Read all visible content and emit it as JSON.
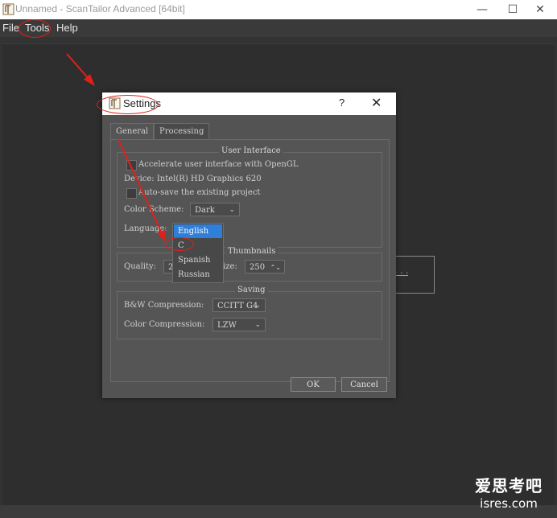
{
  "window": {
    "title": "Unnamed - ScanTailor Advanced [64bit]",
    "minimize_icon": "minimize-icon",
    "maximize_icon": "maximize-icon",
    "close_icon": "close-icon"
  },
  "menubar": {
    "items": [
      "File",
      "Tools",
      "Help"
    ]
  },
  "background": {
    "link_text": ". . ."
  },
  "dialog": {
    "title": "Settings",
    "help": "?",
    "tabs": [
      "General",
      "Processing"
    ],
    "user_interface": {
      "title": "User Interface",
      "accelerate_label": "Accelerate user interface with OpenGL",
      "accelerate_checked": false,
      "device_text": "Device: Intel(R) HD Graphics 620",
      "autosave_label": "Auto-save the existing project",
      "autosave_checked": false,
      "color_scheme_label": "Color Scheme:",
      "color_scheme_value": "Dark",
      "language_label": "Language:",
      "language_options": [
        "English",
        "C",
        "Spanish",
        "Russian"
      ],
      "language_selected": "English"
    },
    "thumbnails": {
      "title": "Thumbnails",
      "quality_label": "Quality:",
      "quality_value_partial": "2",
      "size_label_partial": "ize:",
      "size_value": "250"
    },
    "saving": {
      "title": "Saving",
      "bw_label": "B&W Compression:",
      "bw_value": "CCITT G4",
      "color_label": "Color Compression:",
      "color_value": "LZW"
    },
    "ok_label": "OK",
    "cancel_label": "Cancel"
  },
  "watermark": {
    "line1": "爱思考吧",
    "line2": "isres.com"
  },
  "colors": {
    "annotation_red": "#e0201c",
    "selection_blue": "#2f7fd8"
  }
}
